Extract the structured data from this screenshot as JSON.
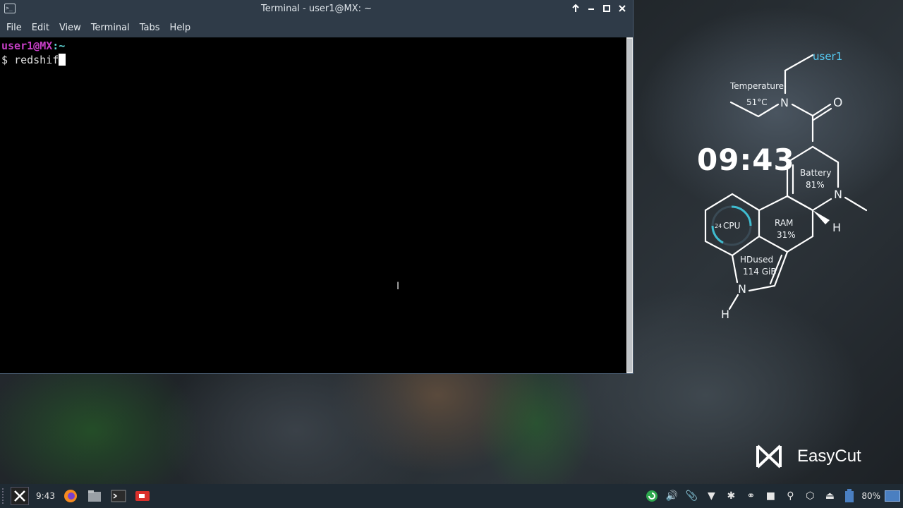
{
  "window": {
    "title": "Terminal - user1@MX: ~",
    "menu": [
      "File",
      "Edit",
      "View",
      "Terminal",
      "Tabs",
      "Help"
    ]
  },
  "terminal": {
    "prompt_user": "user1",
    "prompt_at": "@",
    "prompt_host": "MX",
    "prompt_path": ":~",
    "prompt_symbol": "$",
    "typed": "redshif"
  },
  "conky": {
    "user": "user1",
    "temperature_label": "Temperature:",
    "temperature_value": "51°C",
    "clock": "09:43",
    "battery_label": "Battery",
    "battery_value": "81%",
    "cpu_label": "CPU",
    "cpu_value": "24",
    "ram_label": "RAM",
    "ram_value": "31%",
    "hd_label": "HDused",
    "hd_value": "114 GiB",
    "atom_n": "N",
    "atom_o": "O",
    "atom_h": "H"
  },
  "watermark": {
    "brand": "EasyCut"
  },
  "taskbar": {
    "time": "9:43",
    "battery_percent": "80%"
  }
}
